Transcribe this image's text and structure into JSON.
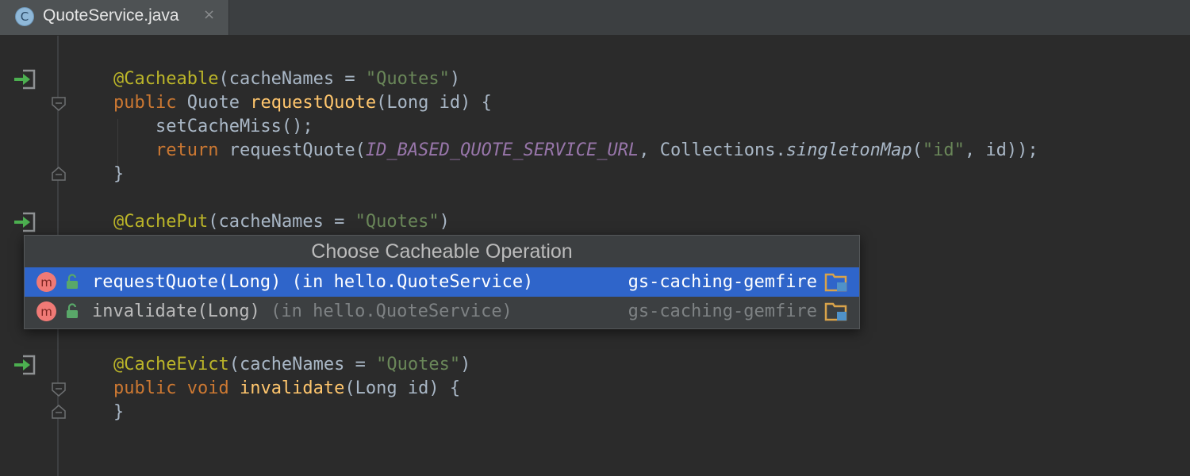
{
  "tab": {
    "icon_letter": "C",
    "title": "QuoteService.java",
    "close": "×"
  },
  "code": {
    "line1": {
      "annotation": "@Cacheable",
      "param": "cacheNames",
      "eq": " = ",
      "string": "\"Quotes\"",
      "close": ")"
    },
    "line2": {
      "kw": "public",
      "type": " Quote ",
      "method": "requestQuote",
      "params": "(Long id) {"
    },
    "line3": {
      "text": "    setCacheMiss();"
    },
    "line4": {
      "kw": "    return",
      "call": " requestQuote(",
      "constant": "ID_BASED_QUOTE_SERVICE_URL",
      "comma": ", Collections.",
      "static_call": "singletonMap",
      "open": "(",
      "string": "\"id\"",
      "rest": ", id));"
    },
    "line5": {
      "text": "}"
    },
    "line6": {
      "annotation": "@CachePut",
      "param": "cacheNames",
      "eq": " = ",
      "string": "\"Quotes\"",
      "close": ")"
    },
    "line7": {
      "annotation": "@CacheEvict",
      "param": "cacheNames",
      "eq": " = ",
      "string": "\"Quotes\"",
      "close": ")"
    },
    "line8": {
      "kw": "public void",
      "space": " ",
      "method": "invalidate",
      "params": "(Long id) {"
    },
    "line9": {
      "text": "}"
    }
  },
  "popup": {
    "title": "Choose Cacheable Operation",
    "items": [
      {
        "icon_letter": "m",
        "method": "requestQuote(Long)",
        "location": " (in hello.QuoteService)",
        "module": "gs-caching-gemfire",
        "selected": true
      },
      {
        "icon_letter": "m",
        "method": "invalidate(Long)",
        "location": " (in hello.QuoteService)",
        "module": "gs-caching-gemfire",
        "selected": false
      }
    ]
  },
  "icons": {
    "gutter": "cache-operation-navigate-icon",
    "method": "method-icon",
    "visibility": "public-lock-icon",
    "module": "module-folder-icon"
  },
  "colors": {
    "background": "#2b2b2b",
    "keyword": "#cc7832",
    "annotation": "#bbb529",
    "method_name": "#ffc66d",
    "string": "#6a8759",
    "constant": "#9876aa",
    "selection": "#2f65ca"
  }
}
